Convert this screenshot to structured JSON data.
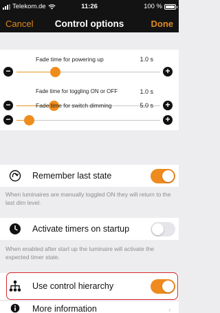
{
  "status_bar": {
    "carrier": "Telekom.de",
    "time": "11:26",
    "battery": "100 %"
  },
  "nav": {
    "cancel": "Cancel",
    "title": "Control options",
    "done": "Done"
  },
  "colors": {
    "accent": "#ee8a1e",
    "header_bg": "#131313",
    "highlight": "#d7262b"
  },
  "sliders": [
    {
      "label": "Fade time for powering up",
      "value": "1.0 s",
      "level": 0.27
    },
    {
      "label": "Fade time for toggling ON or OFF",
      "value": "1.0 s",
      "level": 0.26
    },
    {
      "label": "Fade time for switch dimming",
      "value": "5.0 s",
      "level": 0.09
    }
  ],
  "remember": {
    "label": "Remember last state",
    "on": true,
    "description": "When luminaires are manually toggled ON they will return to the last dim level."
  },
  "timers": {
    "label": "Activate timers on startup",
    "on": false,
    "description": "When enabled after start up the luminaire will activate the expected timer state."
  },
  "hierarchy": {
    "label": "Use control hierarchy",
    "on": true
  },
  "more": {
    "label": "More information"
  }
}
